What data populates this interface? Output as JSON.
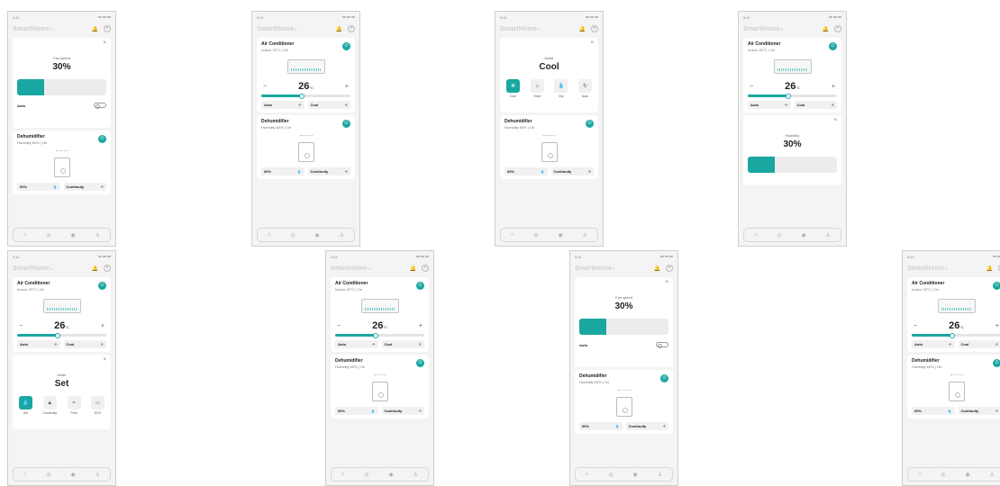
{
  "status": {
    "time": "9:41"
  },
  "app": {
    "brand": "SmartHome",
    "dropdown": "▾"
  },
  "icons": {
    "bell": "🔔",
    "add": "+",
    "close": "×",
    "power": "⏻",
    "fan": "✣",
    "snow": "❄",
    "drop": "💧",
    "home": "⌂",
    "grid": "◎",
    "compass": "◉",
    "user": "♙"
  },
  "ac": {
    "title": "Air Conditioner",
    "subtitle": "Indoor 20°C | On",
    "minus": "−",
    "plus": "+",
    "temp": "26",
    "unit": "°C",
    "level": 0.45,
    "chip_auto": "Auto",
    "chip_cool": "Cool"
  },
  "dh": {
    "title": "Dehumidifier",
    "subtitle": "Humidity 60% | On",
    "chip_humidity": "60%",
    "chip_continuity": "Continuity"
  },
  "fan_popup": {
    "label": "Fan speed",
    "value": "30%",
    "level": 0.3,
    "auto": "Auto"
  },
  "humidity_popup": {
    "label": "Humidity",
    "value": "30%",
    "level": 0.3
  },
  "cool_popup": {
    "label": "Mode",
    "value": "Cool",
    "modes": [
      {
        "label": "Cool",
        "icon": "❄",
        "active": true
      },
      {
        "label": "Heat",
        "icon": "☼",
        "active": false
      },
      {
        "label": "Dry",
        "icon": "💧",
        "active": false
      },
      {
        "label": "Auto",
        "icon": "↻",
        "active": false
      }
    ]
  },
  "set_popup": {
    "label": "Mode",
    "value": "Set",
    "modes": [
      {
        "label": "Set",
        "icon": "💧",
        "active": true
      },
      {
        "label": "Continuity",
        "icon": "▲",
        "active": false
      },
      {
        "label": "Pure",
        "icon": "≈",
        "active": false
      },
      {
        "label": "ECO",
        "icon": "▭",
        "active": false
      }
    ]
  },
  "colors": {
    "accent": "#1aa7a1"
  }
}
